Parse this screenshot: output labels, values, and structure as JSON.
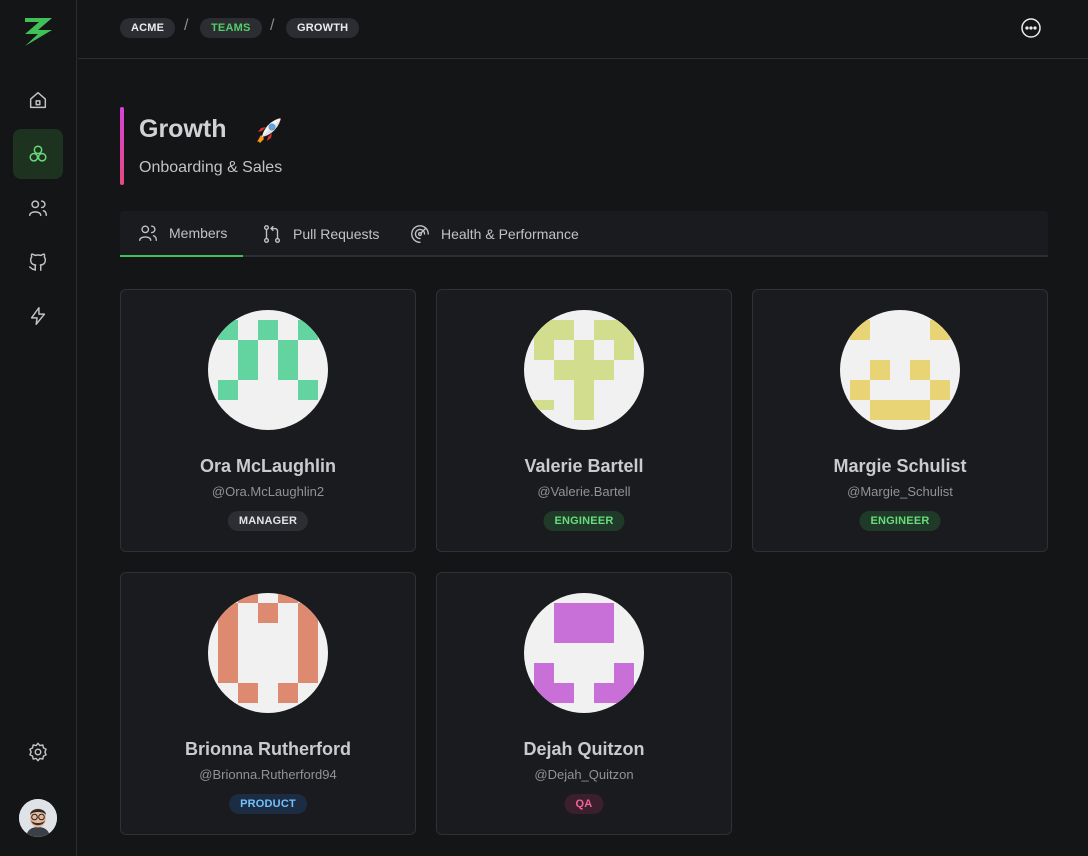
{
  "breadcrumb": [
    {
      "label": "ACME"
    },
    {
      "label": "TEAMS"
    },
    {
      "label": "GROWTH"
    }
  ],
  "team": {
    "title": "Growth",
    "emoji": "rocket",
    "subtitle": "Onboarding & Sales"
  },
  "tabs": [
    {
      "label": "Members",
      "icon": "users-icon",
      "active": true
    },
    {
      "label": "Pull Requests",
      "icon": "git-pull-request-icon",
      "active": false
    },
    {
      "label": "Health & Performance",
      "icon": "performance-icon",
      "active": false
    }
  ],
  "sidebar": {
    "items": [
      "home-icon",
      "teams-icon",
      "users-icon",
      "github-icon",
      "bolt-icon"
    ],
    "active": "teams-icon",
    "bottom": [
      "settings-icon",
      "user-avatar"
    ]
  },
  "members": [
    {
      "name": "Ora McLaughlin",
      "handle": "@Ora.McLaughlin2",
      "role": "MANAGER",
      "avatar_color": "#63d3a0"
    },
    {
      "name": "Valerie Bartell",
      "handle": "@Valerie.Bartell",
      "role": "ENGINEER",
      "avatar_color": "#d2dd8e"
    },
    {
      "name": "Margie Schulist",
      "handle": "@Margie_Schulist",
      "role": "ENGINEER",
      "avatar_color": "#e8d474"
    },
    {
      "name": "Brionna Rutherford",
      "handle": "@Brionna.Rutherford94",
      "role": "PRODUCT",
      "avatar_color": "#de8a70"
    },
    {
      "name": "Dejah Quitzon",
      "handle": "@Dejah_Quitzon",
      "role": "QA",
      "avatar_color": "#c86fd8"
    }
  ],
  "colors": {
    "accent": "#40c057",
    "title_bar_gradient": [
      "#d444d8",
      "#e64980"
    ]
  }
}
